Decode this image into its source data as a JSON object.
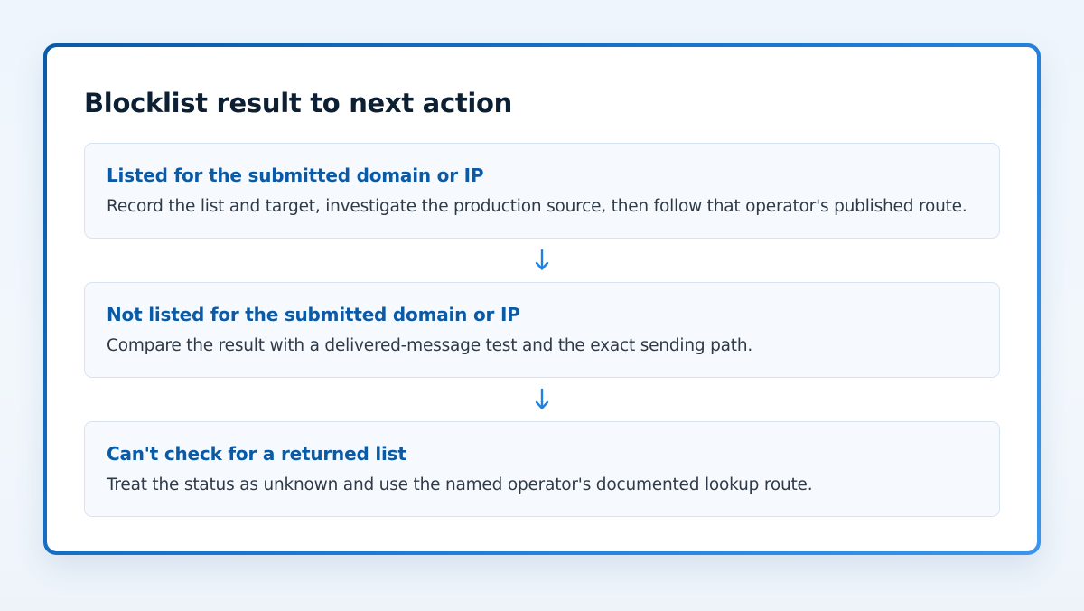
{
  "diagram": {
    "title": "Blocklist result to next action",
    "steps": [
      {
        "heading": "Listed for the submitted domain or IP",
        "body": "Record the list and target, investigate the production source, then follow that operator's published route."
      },
      {
        "heading": "Not listed for the submitted domain or IP",
        "body": "Compare the result with a delivered-message test and the exact sending path."
      },
      {
        "heading": "Can't check for a returned list",
        "body": "Treat the status as unknown and use the named operator's documented lookup route."
      }
    ]
  },
  "colors": {
    "accent": "#1e7ad6",
    "heading": "#0a5aa6",
    "title": "#0c1f33",
    "arrow": "#1f82e0"
  },
  "icons": {
    "connector": "arrow-down-icon"
  }
}
